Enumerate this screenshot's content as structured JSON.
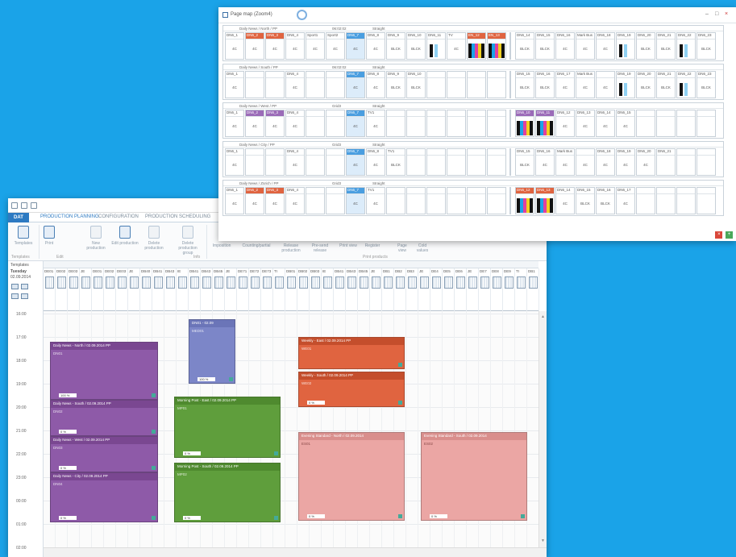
{
  "map_window": {
    "title": "Page map (Zoom4)",
    "controls": {
      "min": "–",
      "max": "□",
      "close": "×"
    },
    "sections": [
      {
        "header": [
          "Daily News / North / PP",
          "06:02:02",
          "Straight"
        ],
        "pages": [
          "DN6_1",
          "DN6_2",
          "DN6_3",
          "DN6_4",
          "Sport1",
          "Sport2",
          "DN6_7",
          "DN6_8",
          "DN6_9",
          "DN6_10",
          "DN6_11",
          "TV",
          "EN_12",
          "EN_13",
          "DN6_14",
          "DN6_15",
          "DN6_16",
          "Mark Bus",
          "DN6_18",
          "DN6_19",
          "DN6_20",
          "DN6_21",
          "DN6_22",
          "DN6_23"
        ],
        "contents": [
          "4C",
          "4C",
          "4C",
          "4C",
          "4C",
          "4C",
          "4C",
          "4C",
          "BLCK",
          "BLCK",
          "BLCK",
          "4C",
          "",
          "",
          "BLCK",
          "BLCK",
          "4C",
          "4C",
          "4C",
          "BLCK",
          "BLCK",
          "BLCK",
          "BLCK",
          "BLCK"
        ]
      },
      {
        "header": [
          "Daily News / South / PP",
          "06:02:02",
          "Straight"
        ],
        "pages": [
          "DN6_1",
          "",
          "",
          "DN6_4",
          "",
          "",
          "DN6_7",
          "DN6_8",
          "DN6_9",
          "DN6_10",
          "",
          "",
          "",
          "",
          "DN6_15",
          "DN6_16",
          "DN6_17",
          "Mark Bus",
          "",
          "DN6_19",
          "DN6_20",
          "DN6_21",
          "DN6_22",
          "DN6_23"
        ],
        "contents": [
          "4C",
          "",
          "",
          "4C",
          "",
          "",
          "4C",
          "4C",
          "BLCK",
          "BLCK",
          "",
          "",
          "",
          "",
          "BLCK",
          "BLCK",
          "4C",
          "4C",
          "4C",
          "BLCK",
          "BLCK",
          "BLCK",
          "BLCK",
          "BLCK"
        ]
      },
      {
        "header": [
          "Daily News / West / PP",
          "Grid3",
          "Straight"
        ],
        "pages": [
          "DN6_1",
          "DN6_2",
          "DN6_3",
          "DN6_4",
          "",
          "",
          "DN6_7",
          "TV1",
          "",
          "",
          "",
          "",
          "",
          "",
          "DN6_10",
          "DN6_11",
          "DN6_12",
          "DN6_13",
          "DN6_14",
          "DN6_15",
          "",
          "",
          "",
          ""
        ],
        "contents": [
          "4C",
          "4C",
          "4C",
          "4C",
          "",
          "",
          "4C",
          "4C",
          "",
          "",
          "",
          "",
          "",
          "",
          "4C",
          "4C",
          "4C",
          "4C",
          "4C",
          "4C",
          "",
          "",
          "",
          ""
        ]
      },
      {
        "header": [
          "Daily News / City / PP",
          "Grid3",
          "Straight"
        ],
        "pages": [
          "DN6_1",
          "",
          "",
          "DN6_4",
          "",
          "",
          "DN6_7",
          "DN6_8",
          "TV1",
          "",
          "",
          "",
          "",
          "",
          "DN6_15",
          "DN6_16",
          "Mark Bus",
          "",
          "DN6_18",
          "DN6_19",
          "DN6_20",
          "DN6_21",
          "",
          ""
        ],
        "contents": [
          "4C",
          "",
          "",
          "4C",
          "",
          "",
          "4C",
          "4C",
          "BLCK",
          "",
          "",
          "",
          "",
          "",
          "BLCK",
          "4C",
          "4C",
          "4C",
          "4C",
          "4C",
          "4C",
          "",
          "",
          ""
        ]
      },
      {
        "header": [
          "Daily News / Zürich / PP",
          "Grid3",
          "Straight"
        ],
        "pages": [
          "DN6_1",
          "DN6_2",
          "DN6_3",
          "DN6_4",
          "",
          "",
          "DN6_7",
          "TV1",
          "",
          "",
          "",
          "",
          "",
          "",
          "DN6_12",
          "DN6_13",
          "DN6_14",
          "DN6_15",
          "DN6_16",
          "DN6_17",
          "",
          "",
          "",
          ""
        ],
        "contents": [
          "4C",
          "4C",
          "4C",
          "4C",
          "",
          "",
          "4C",
          "4C",
          "",
          "",
          "",
          "",
          "",
          "",
          "4C",
          "4C",
          "4C",
          "BLCK",
          "BLCK",
          "4C",
          "",
          "",
          "",
          ""
        ]
      }
    ]
  },
  "scheduler": {
    "tabs": [
      "DAT",
      "PRODUCTION PLANNING",
      "CONFIGURATION",
      "PRODUCTION SCHEDULING"
    ],
    "ribbon": {
      "buttons": [
        "Templates",
        "Print",
        "New production",
        "Edit production",
        "Delete production",
        "Delete production group",
        "Imposition",
        "Counting/partial",
        "Release production",
        "Pre-send release"
      ],
      "group_labels": [
        "Templates",
        "Edit",
        "Info",
        "Print products"
      ],
      "options": [
        "Print view",
        "Register",
        "Page view",
        "Cold values"
      ]
    },
    "left": {
      "label": "Templates",
      "day": "Tuesday",
      "date": "02.09.2014"
    },
    "lanes": [
      "DE01",
      "DE02",
      "DE03",
      "JE",
      "DE01",
      "DE02",
      "DE03",
      "JE",
      "DB40",
      "DB41",
      "DB43",
      "IE",
      "DB41",
      "DB43",
      "DB45",
      "JE",
      "DE71",
      "DE72",
      "DE73",
      "TI",
      "DB01",
      "DB02",
      "DB03",
      "IE",
      "DB41",
      "DB43",
      "DB45",
      "JE",
      "DB1",
      "DB2",
      "DB3",
      "JE",
      "DE4",
      "DE5",
      "DE6",
      "JE",
      "DE7",
      "DE8",
      "DE9",
      "TI",
      "DB1"
    ],
    "times": [
      "16:00",
      "17:00",
      "18:00",
      "19:00",
      "20:00",
      "21:00",
      "22:00",
      "23:00",
      "00:00",
      "01:00",
      "02:00"
    ],
    "blocks": [
      {
        "id": "p1",
        "title": "Daily News - North / 02.09.2014 PP",
        "sub": "DN01",
        "pct": "100 %",
        "color": "purple"
      },
      {
        "id": "p2",
        "title": "Daily News - South / 02.09.2014 PP",
        "sub": "DN02",
        "pct": "0 %",
        "color": "purple"
      },
      {
        "id": "p3",
        "title": "Daily News - West / 02.09.2014 PP",
        "sub": "DN03",
        "pct": "0 %",
        "color": "purple"
      },
      {
        "id": "p4",
        "title": "Daily News - City / 02.09.2014 PP",
        "sub": "DN04",
        "pct": "0 %",
        "color": "purple"
      },
      {
        "id": "b1",
        "title": "DN01 - 02.09",
        "sub": "MED01",
        "pct": "100 %",
        "color": "blue"
      },
      {
        "id": "g1",
        "title": "Morning Post - East / 02.09.2014 PP",
        "sub": "MP01",
        "pct": "0 %",
        "color": "green"
      },
      {
        "id": "g2",
        "title": "Morning Post - South / 02.09.2014 PP",
        "sub": "MP02",
        "pct": "0 %",
        "color": "green"
      },
      {
        "id": "o1",
        "title": "Weekly - East / 02.09.2014 PP",
        "sub": "WE01",
        "pct": "",
        "color": "orange"
      },
      {
        "id": "o2",
        "title": "Weekly - South / 02.09.2014 PP",
        "sub": "WE02",
        "pct": "0 %",
        "color": "orange"
      },
      {
        "id": "k1",
        "title": "Evening Standard - North / 02.09.2014",
        "sub": "ES01",
        "pct": "0 %",
        "color": "pink"
      },
      {
        "id": "k2",
        "title": "Evening Standard - South / 02.09.2014",
        "sub": "ES02",
        "pct": "0 %",
        "color": "pink"
      }
    ]
  }
}
